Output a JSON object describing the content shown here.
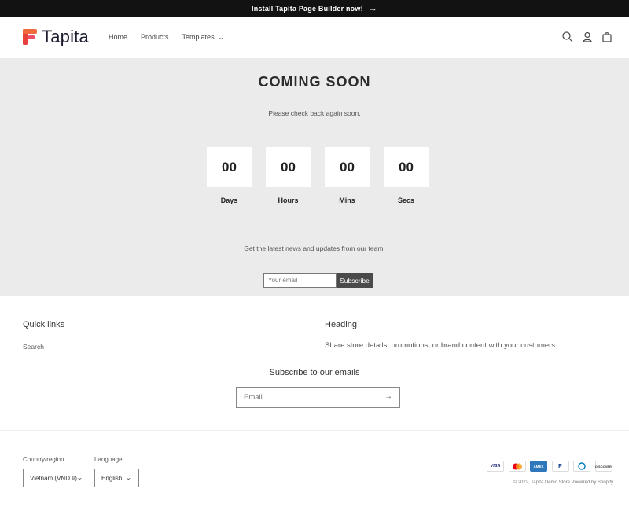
{
  "announcement": {
    "text": "Install Tapita Page Builder now!",
    "arrow": "→"
  },
  "header": {
    "logo_text": "Tapita",
    "nav": {
      "home": "Home",
      "products": "Products",
      "templates": "Templates"
    },
    "icons": [
      "search-icon",
      "account-icon",
      "cart-icon"
    ]
  },
  "hero": {
    "title": "COMING SOON",
    "subtitle": "Please check back again soon.",
    "timers": [
      {
        "value": "00",
        "label": "Days"
      },
      {
        "value": "00",
        "label": "Hours"
      },
      {
        "value": "00",
        "label": "Mins"
      },
      {
        "value": "00",
        "label": "Secs"
      }
    ],
    "news_text": "Get the latest news and updates from our team.",
    "email_placeholder": "Your email",
    "subscribe_label": "Subscribe"
  },
  "footer": {
    "quick_links_title": "Quick links",
    "quick_links": [
      "Search"
    ],
    "heading_title": "Heading",
    "heading_text": "Share store details, promotions, or brand content with your customers.",
    "subscribe_title": "Subscribe to our emails",
    "email_placeholder": "Email",
    "country_label": "Country/region",
    "country_value": "Vietnam (VND ₫)",
    "language_label": "Language",
    "language_value": "English",
    "payments": [
      "VISA",
      "Mastercard",
      "AMEX",
      "PayPal",
      "Diners",
      "DISCOVER"
    ],
    "copyright": "© 2022, Tapita Demo Store Powered by Shopify"
  },
  "colors": {
    "hero_bg": "#ebebeb",
    "announcement_bg": "#121212",
    "brand": "#e8423f",
    "subscribe_btn": "#4a4a4a"
  }
}
